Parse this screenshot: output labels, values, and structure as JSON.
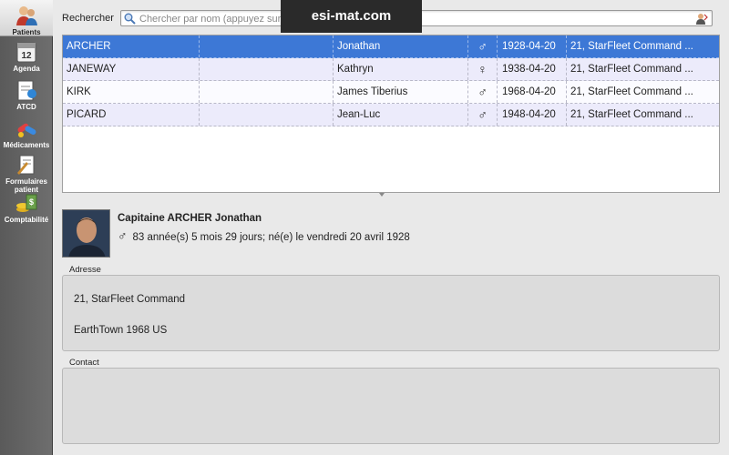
{
  "watermark": "esi-mat.com",
  "sidebar": {
    "items": [
      {
        "label": "Patients",
        "icon": "patients-icon",
        "active": true
      },
      {
        "label": "Agenda",
        "icon": "agenda-calendar-icon",
        "day": "12"
      },
      {
        "label": "ATCD",
        "icon": "atcd-icon"
      },
      {
        "label": "Médicaments",
        "icon": "medications-icon"
      },
      {
        "label": "Formulaires patient",
        "icon": "patient-forms-icon"
      },
      {
        "label": "Comptabilité",
        "icon": "accounting-icon"
      }
    ]
  },
  "search": {
    "label": "Rechercher",
    "placeholder": "Chercher par nom (appuyez sur Alt pour faire défiler)"
  },
  "patients": {
    "rows": [
      {
        "lastname": "ARCHER",
        "firstname": "Jonathan",
        "sex": "♂",
        "dob": "1928-04-20",
        "address": "21, StarFleet Command ..."
      },
      {
        "lastname": "JANEWAY",
        "firstname": "Kathryn",
        "sex": "♀",
        "dob": "1938-04-20",
        "address": "21, StarFleet Command ..."
      },
      {
        "lastname": "KIRK",
        "firstname": "James Tiberius",
        "sex": "♂",
        "dob": "1968-04-20",
        "address": "21, StarFleet Command ..."
      },
      {
        "lastname": "PICARD",
        "firstname": "Jean-Luc",
        "sex": "♂",
        "dob": "1948-04-20",
        "address": "21, StarFleet Command ..."
      }
    ]
  },
  "selected_patient": {
    "name": "Capitaine ARCHER Jonathan",
    "sex": "♂",
    "age_line": "83 année(s) 5 mois 29 jours; né(e) le vendredi 20 avril 1928"
  },
  "address_group": {
    "label": "Adresse",
    "line1": "21, StarFleet Command",
    "line2": "EarthTown 1968 US"
  },
  "contact_group": {
    "label": "Contact"
  },
  "colors": {
    "selection": "#3d78d6",
    "row_alt": "#ecebfb",
    "sidebar": "#5a5a5a"
  }
}
